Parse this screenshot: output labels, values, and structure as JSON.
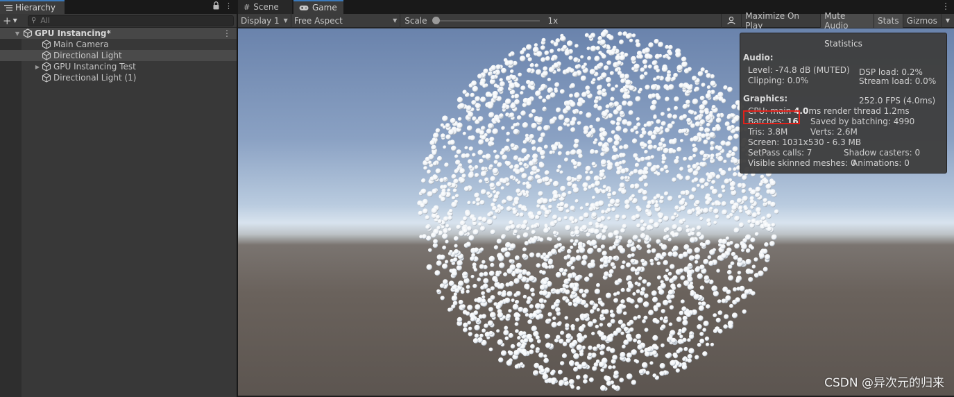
{
  "hierarchy": {
    "tab_label": "Hierarchy",
    "lock_icon": "lock-icon",
    "menu_icon": "kebab-icon",
    "add_label": "+",
    "search_placeholder": "All",
    "scene_name": "GPU Instancing*",
    "items": [
      {
        "label": "Main Camera",
        "icon": "gameobject-cube-icon",
        "expandable": false,
        "selected": false
      },
      {
        "label": "Directional Light",
        "icon": "gameobject-cube-icon",
        "expandable": false,
        "selected": true
      },
      {
        "label": "GPU Instancing Test",
        "icon": "gameobject-cube-icon",
        "expandable": true,
        "selected": false
      },
      {
        "label": "Directional Light (1)",
        "icon": "gameobject-cube-icon",
        "expandable": false,
        "selected": false
      }
    ]
  },
  "game_view": {
    "tabs": [
      {
        "label": "Scene",
        "icon": "grid-icon"
      },
      {
        "label": "Game",
        "icon": "gamepad-icon"
      }
    ],
    "display": "Display 1",
    "aspect": "Free Aspect",
    "scale_label": "Scale",
    "scale_value": "1x",
    "buttons": {
      "maximize": "Maximize On Play",
      "mute": "Mute Audio",
      "stats": "Stats",
      "gizmos": "Gizmos"
    }
  },
  "statistics": {
    "title": "Statistics",
    "audio_header": "Audio:",
    "level": "Level: -74.8 dB (MUTED)",
    "clipping": "Clipping: 0.0%",
    "dsp_load": "DSP load: 0.2%",
    "stream_load": "Stream load: 0.0%",
    "graphics_header": "Graphics:",
    "fps": "252.0 FPS (4.0ms)",
    "cpu_prefix": "CPU: main ",
    "cpu_main": "4.0",
    "cpu_suffix": "ms  render thread 1.2ms",
    "batches_prefix": "Batches: ",
    "batches_value": "16",
    "saved_by_batching": "Saved by batching: 4990",
    "tris": "Tris: 3.8M",
    "verts": "Verts: 2.6M",
    "screen": "Screen: 1031x530 - 6.3 MB",
    "setpass": "SetPass calls: 7",
    "shadow_casters": "Shadow casters: 0",
    "skinned": "Visible skinned meshes: 0",
    "animations": "Animations: 0",
    "highlight_color": "#e0211a"
  },
  "watermark": "CSDN @异次元的归来",
  "colors": {
    "accent_tab": "#3a79bb",
    "sphere_color": "#eef2f6"
  }
}
